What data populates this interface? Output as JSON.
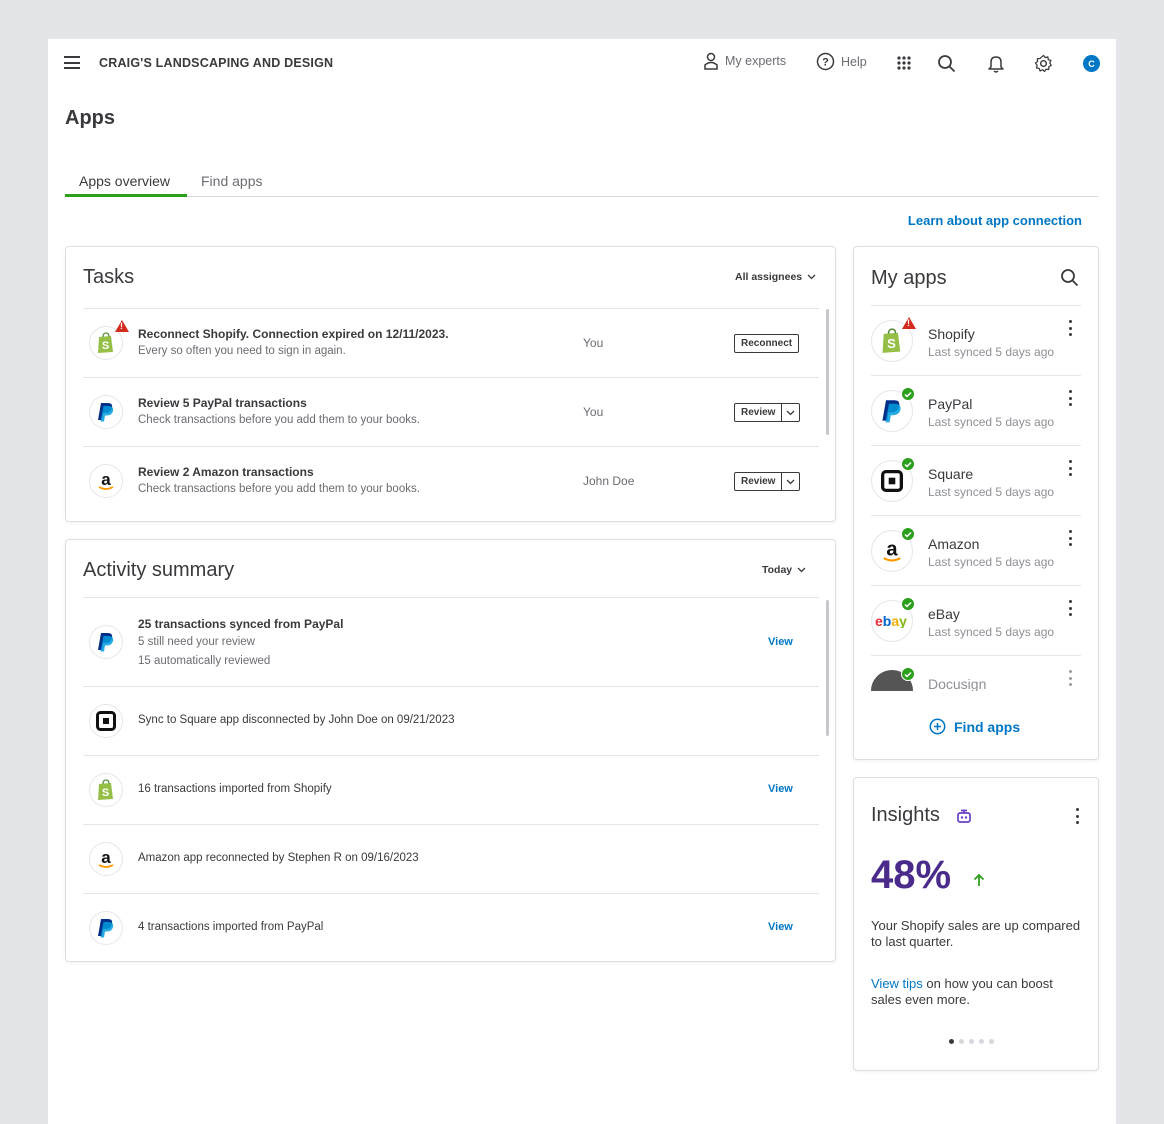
{
  "header": {
    "company": "CRAIG'S LANDSCAPING AND DESIGN",
    "my_experts": "My experts",
    "help": "Help",
    "avatar_initial": "C"
  },
  "page": {
    "title": "Apps"
  },
  "tabs": [
    {
      "label": "Apps overview",
      "active": true
    },
    {
      "label": "Find apps",
      "active": false
    }
  ],
  "learn_link": "Learn about app connection",
  "tasks": {
    "title": "Tasks",
    "filter": "All assignees",
    "rows": [
      {
        "icon": "shopify-icon",
        "title": "Reconnect Shopify. Connection expired on 12/11/2023.",
        "subtitle": "Every so often you need to sign in again.",
        "assignee": "You",
        "action": "Reconnect"
      },
      {
        "icon": "paypal-icon",
        "title": "Review 5 PayPal transactions",
        "subtitle": "Check transactions before you add them to your books.",
        "assignee": "You",
        "action": "Review"
      },
      {
        "icon": "amazon-icon",
        "title": "Review 2 Amazon transactions",
        "subtitle": "Check transactions before you add them to your books.",
        "assignee": "John Doe",
        "action": "Review"
      }
    ]
  },
  "activity": {
    "title": "Activity summary",
    "filter": "Today",
    "rows": [
      {
        "icon": "paypal-icon",
        "title": "25 transactions synced from PayPal",
        "line2": "5 still need your review",
        "line3": "15 automatically reviewed",
        "link": "View"
      },
      {
        "icon": "square-icon",
        "text": "Sync to Square app disconnected by John Doe on 09/21/2023"
      },
      {
        "icon": "shopify-icon",
        "text": "16 transactions imported from Shopify",
        "link": "View"
      },
      {
        "icon": "amazon-icon",
        "text": "Amazon app reconnected by Stephen R on 09/16/2023"
      },
      {
        "icon": "paypal-icon",
        "text": "4 transactions imported from PayPal",
        "link": "View"
      }
    ]
  },
  "my_apps": {
    "title": "My apps",
    "apps": [
      {
        "name": "Shopify",
        "status": "Last synced 5 days ago",
        "state": "error"
      },
      {
        "name": "PayPal",
        "status": "Last synced 5 days ago",
        "state": "ok"
      },
      {
        "name": "Square",
        "status": "Last synced 5 days ago",
        "state": "ok"
      },
      {
        "name": "Amazon",
        "status": "Last synced 5 days ago",
        "state": "ok"
      },
      {
        "name": "eBay",
        "status": "Last synced 5 days ago",
        "state": "ok"
      },
      {
        "name": "Docusign",
        "state": "ok"
      }
    ],
    "find_apps": "Find apps"
  },
  "insights": {
    "title": "Insights",
    "percent": "48%",
    "text": "Your Shopify sales are up compared to last quarter.",
    "link": "View tips",
    "link_suffix": " on how you can boost sales even more.",
    "pages": 5,
    "current_page": 1
  },
  "colors": {
    "brand_blue": "#0077c5",
    "green": "#2ca01c",
    "insight_purple": "#4a2b8c",
    "alert_red": "#d52b1e"
  }
}
